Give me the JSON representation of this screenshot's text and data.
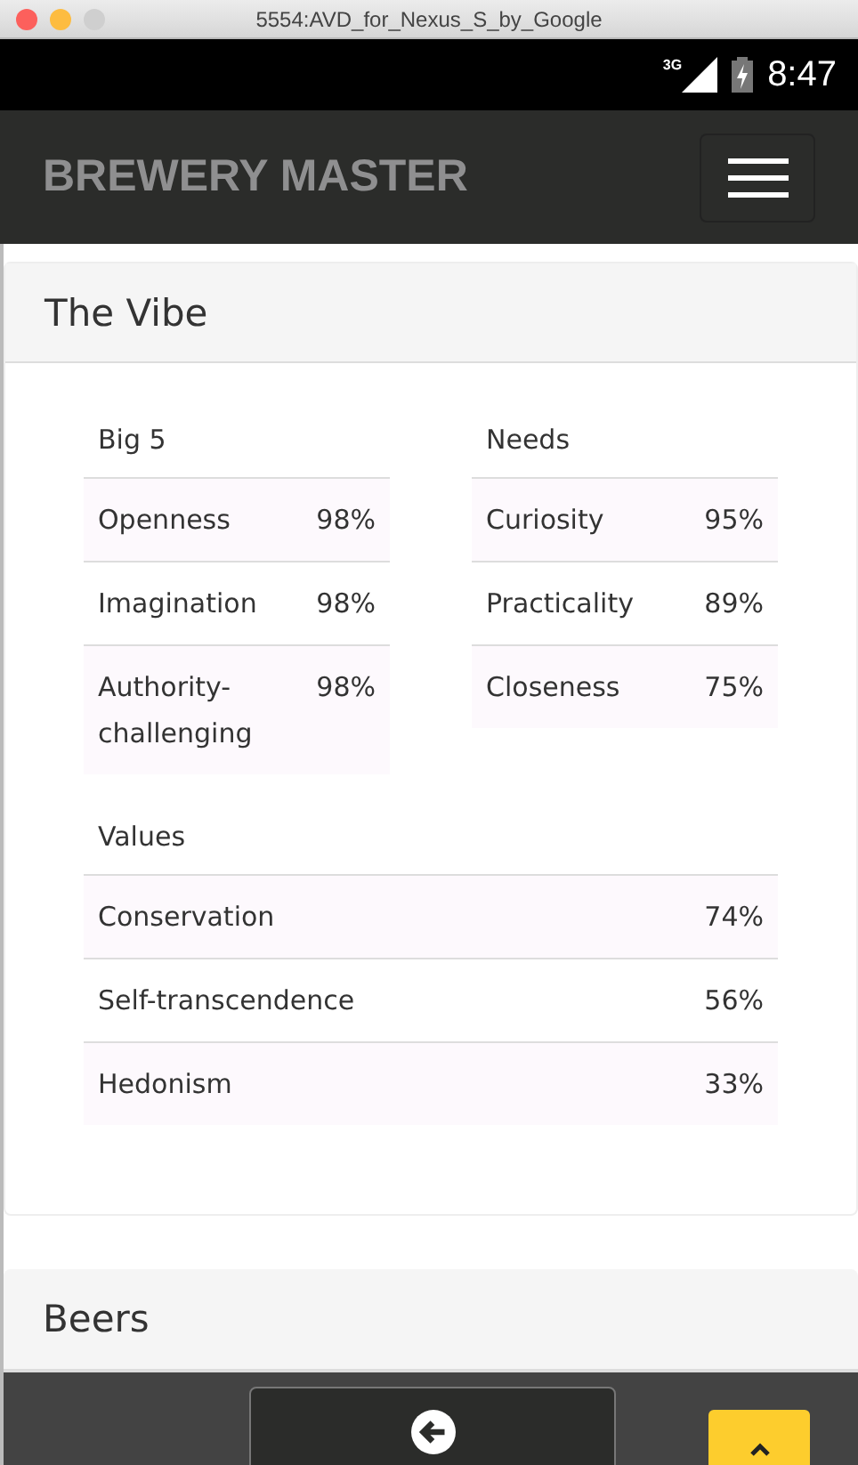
{
  "window": {
    "title": "5554:AVD_for_Nexus_S_by_Google"
  },
  "status_bar": {
    "network": "3G",
    "time": "8:47"
  },
  "navbar": {
    "brand": "BREWERY MASTER"
  },
  "vibe": {
    "title": "The Vibe",
    "tables": [
      {
        "heading": "Big 5",
        "rows": [
          {
            "label": "Openness",
            "value": "98%"
          },
          {
            "label": "Imagination",
            "value": "98%"
          },
          {
            "label": "Authority-challenging",
            "value": "98%"
          }
        ]
      },
      {
        "heading": "Needs",
        "rows": [
          {
            "label": "Curiosity",
            "value": "95%"
          },
          {
            "label": "Practicality",
            "value": "89%"
          },
          {
            "label": "Closeness",
            "value": "75%"
          }
        ]
      }
    ],
    "values_table": {
      "heading": "Values",
      "rows": [
        {
          "label": "Conservation",
          "value": "74%"
        },
        {
          "label": "Self-transcendence",
          "value": "56%"
        },
        {
          "label": "Hedonism",
          "value": "33%"
        }
      ]
    }
  },
  "beers": {
    "title": "Beers"
  }
}
